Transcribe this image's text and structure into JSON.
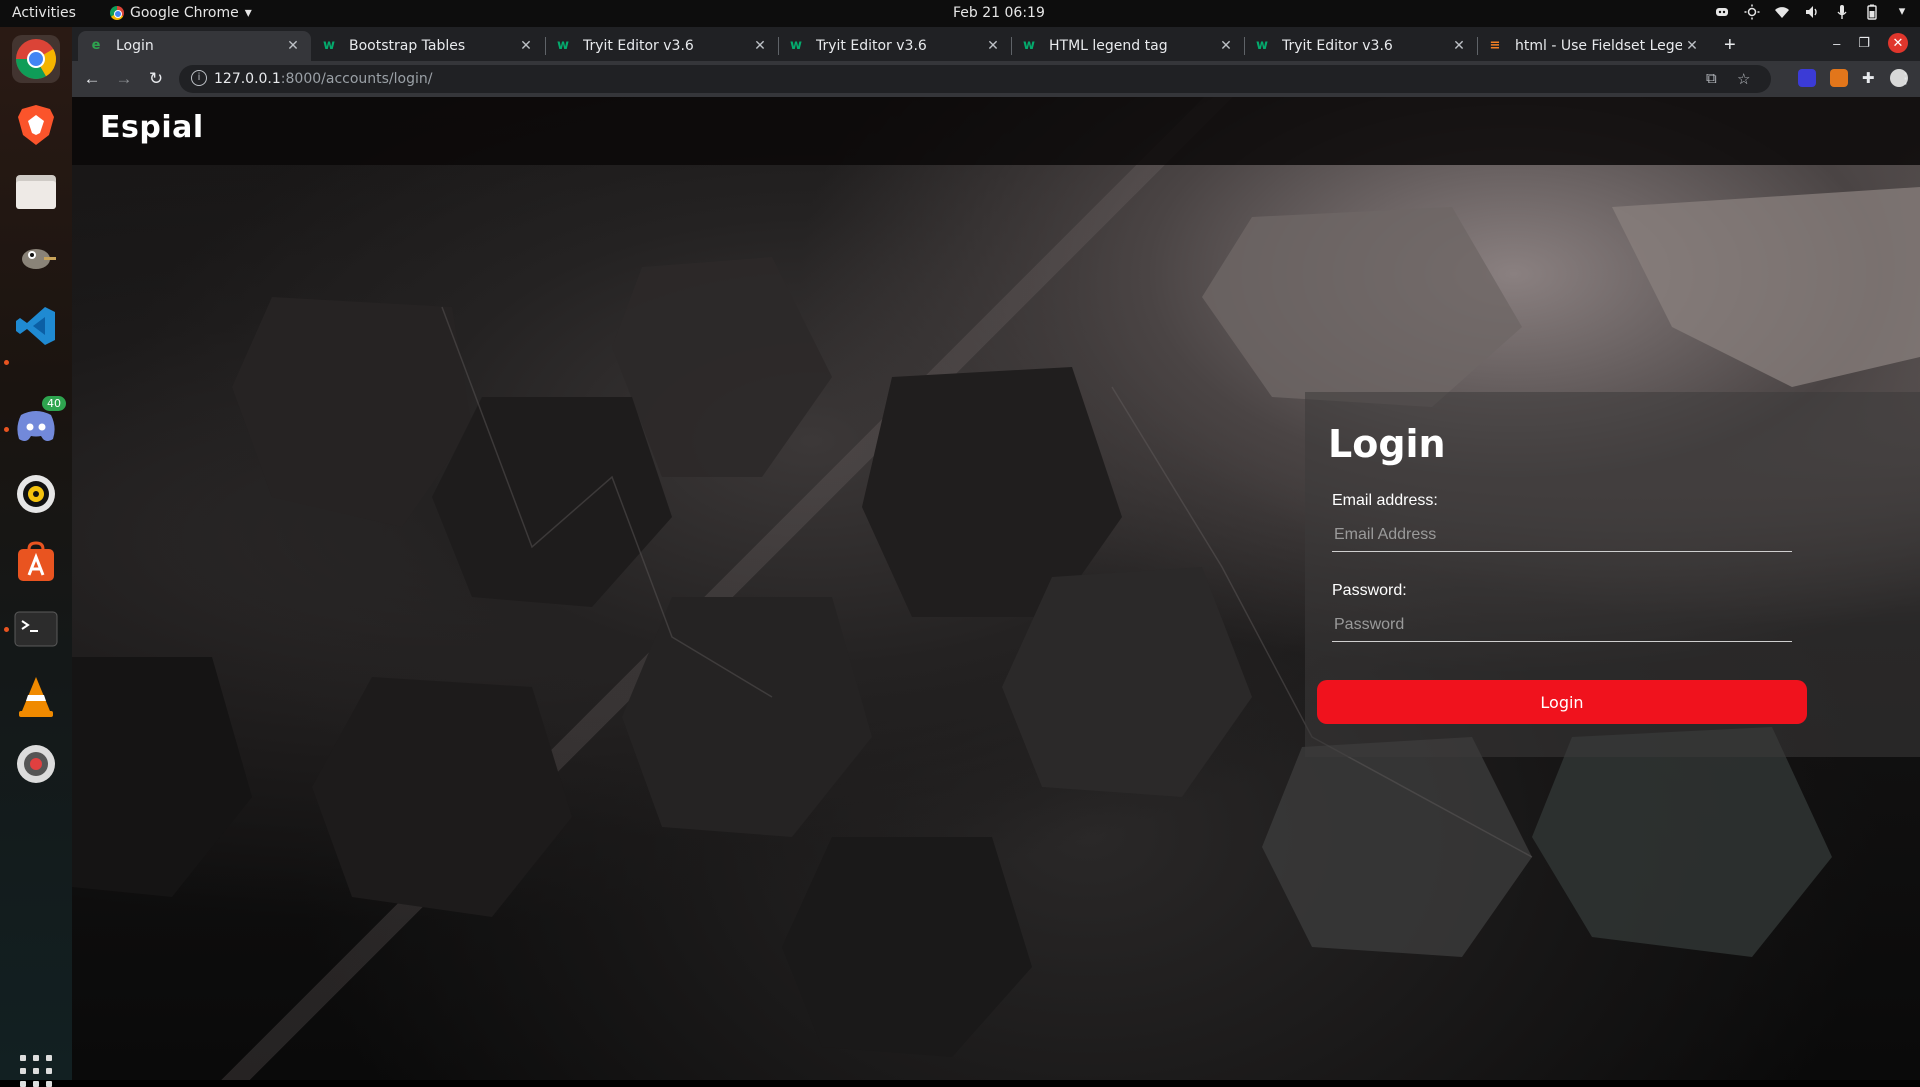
{
  "os_bar": {
    "activities": "Activities",
    "app_name": "Google Chrome",
    "app_menu_arrow": "▾",
    "clock": "Feb 21  06:19"
  },
  "dock": {
    "discord_badge": "40",
    "items": [
      "chrome-icon",
      "brave-icon",
      "files-icon",
      "gimp-icon",
      "vscode-icon",
      "discord-icon",
      "rhythmbox-icon",
      "software-icon",
      "terminal-icon",
      "vlc-icon",
      "installer-icon"
    ]
  },
  "tabs": [
    {
      "title": "Login",
      "favicon": "espial-icon",
      "active": true
    },
    {
      "title": "Bootstrap Tables",
      "favicon": "w3-icon",
      "active": false
    },
    {
      "title": "Tryit Editor v3.6",
      "favicon": "w3-icon",
      "active": false
    },
    {
      "title": "Tryit Editor v3.6",
      "favicon": "w3-icon",
      "active": false
    },
    {
      "title": "HTML legend tag",
      "favicon": "w3-icon",
      "active": false
    },
    {
      "title": "Tryit Editor v3.6",
      "favicon": "w3-icon",
      "active": false
    },
    {
      "title": "html - Use Fieldset Legen",
      "favicon": "stackoverflow-icon",
      "active": false
    }
  ],
  "address_bar": {
    "host": "127.0.0.1",
    "path": ":8000/accounts/login/"
  },
  "site": {
    "brand": "Espial"
  },
  "login": {
    "title": "Login",
    "email_label": "Email address:",
    "email_placeholder": "Email Address",
    "email_value": "",
    "password_label": "Password:",
    "password_placeholder": "Password",
    "password_value": "",
    "submit_label": "Login"
  },
  "colors": {
    "accent": "#f0121d",
    "w3_green": "#04aa6d"
  }
}
